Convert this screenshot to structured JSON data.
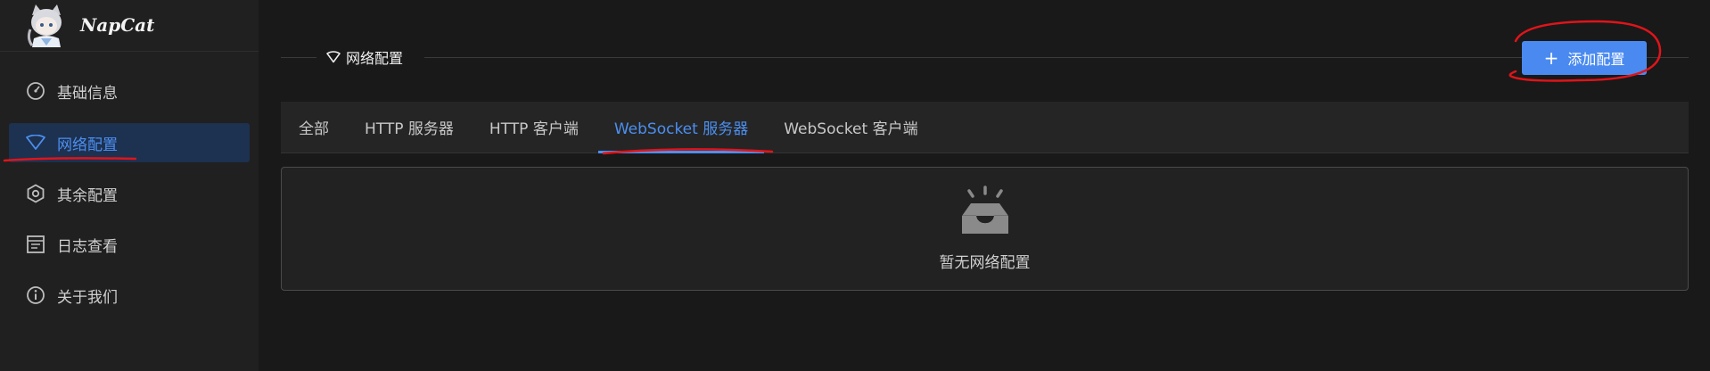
{
  "brand": {
    "name": "NapCat"
  },
  "sidebar": {
    "items": [
      {
        "label": "基础信息",
        "icon": "dashboard-icon"
      },
      {
        "label": "网络配置",
        "icon": "wifi-icon",
        "active": true
      },
      {
        "label": "其余配置",
        "icon": "settings-hex-icon"
      },
      {
        "label": "日志查看",
        "icon": "log-icon"
      },
      {
        "label": "关于我们",
        "icon": "info-icon"
      }
    ]
  },
  "section": {
    "title": "网络配置",
    "icon": "wifi-icon"
  },
  "toolbar": {
    "add_label": "添加配置"
  },
  "tabs": [
    {
      "label": "全部"
    },
    {
      "label": "HTTP 服务器"
    },
    {
      "label": "HTTP 客户端"
    },
    {
      "label": "WebSocket 服务器",
      "active": true
    },
    {
      "label": "WebSocket 客户端"
    }
  ],
  "empty": {
    "text": "暂无网络配置",
    "icon": "empty-inbox-icon"
  },
  "colors": {
    "accent": "#4a8af0",
    "annotation": "#e0141a",
    "background": "#191919",
    "sidebar": "#202020"
  }
}
